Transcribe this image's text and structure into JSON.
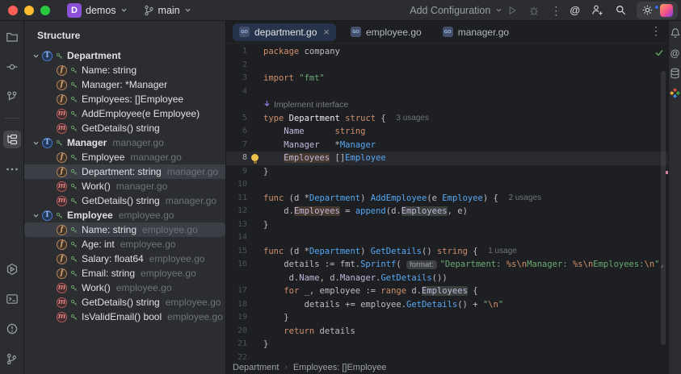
{
  "colors": {
    "accent": "#3574F0",
    "editor_bg": "#1E1F22",
    "panel_bg": "#2B2D30",
    "keyword": "#CF8E6D",
    "string": "#6AAB73",
    "function": "#56A8F5",
    "selection_row": "#3B3E44"
  },
  "window": {
    "project_badge": "D",
    "project": "demos",
    "branch": "main",
    "run_config": "Add Configuration",
    "window_controls": [
      "close",
      "minimize",
      "zoom"
    ],
    "topbar_icons": [
      "chevron-down",
      "git-branch",
      "run",
      "debug",
      "kebab-menu",
      "ai-assistant",
      "add-user",
      "search",
      "settings",
      "avatar"
    ]
  },
  "left_toolbar": {
    "top": [
      "folder",
      "commit",
      "vcs-graph",
      "structure",
      "more"
    ],
    "active": "structure",
    "bottom": [
      "run",
      "terminal",
      "problems",
      "git-branch"
    ]
  },
  "right_toolbar": [
    "notifications",
    "ai-assistant",
    "database",
    "plugins"
  ],
  "icons": {
    "kebab": "⋮",
    "close": "×",
    "more_dots": "···",
    "at": "@"
  },
  "structure_panel": {
    "title": "Structure",
    "items": [
      {
        "kind": "T",
        "label": "Department",
        "indent": 0,
        "chevron": true
      },
      {
        "kind": "f",
        "label": "Name: string",
        "indent": 1
      },
      {
        "kind": "f",
        "label": "Manager: *Manager",
        "indent": 1
      },
      {
        "kind": "f",
        "label": "Employees: []Employee",
        "indent": 1
      },
      {
        "kind": "m",
        "label": "AddEmployee(e Employee)",
        "indent": 1
      },
      {
        "kind": "m",
        "label": "GetDetails() string",
        "indent": 1
      },
      {
        "kind": "T",
        "label": "Manager",
        "suffix": "manager.go",
        "indent": 0,
        "chevron": true
      },
      {
        "kind": "f",
        "label": "Employee",
        "suffix": "manager.go",
        "indent": 1
      },
      {
        "kind": "f",
        "label": "Department: string",
        "suffix": "manager.go",
        "indent": 1,
        "selected": true
      },
      {
        "kind": "m",
        "label": "Work()",
        "suffix": "manager.go",
        "indent": 1
      },
      {
        "kind": "m",
        "label": "GetDetails() string",
        "suffix": "manager.go",
        "indent": 1
      },
      {
        "kind": "T",
        "label": "Employee",
        "suffix": "employee.go",
        "indent": 0,
        "chevron": true
      },
      {
        "kind": "f",
        "label": "Name: string",
        "suffix": "employee.go",
        "indent": 1,
        "selected": true,
        "rounded": true
      },
      {
        "kind": "f",
        "label": "Age: int",
        "suffix": "employee.go",
        "indent": 1
      },
      {
        "kind": "f",
        "label": "Salary: float64",
        "suffix": "employee.go",
        "indent": 1
      },
      {
        "kind": "f",
        "label": "Email: string",
        "suffix": "employee.go",
        "indent": 1
      },
      {
        "kind": "m",
        "label": "Work()",
        "suffix": "employee.go",
        "indent": 1
      },
      {
        "kind": "m",
        "label": "GetDetails() string",
        "suffix": "employee.go",
        "indent": 1
      },
      {
        "kind": "m",
        "label": "IsValidEmail() bool",
        "suffix": "employee.go",
        "indent": 1
      }
    ]
  },
  "editor": {
    "tabs": [
      {
        "label": "department.go",
        "active": true,
        "close_icon": true
      },
      {
        "label": "employee.go"
      },
      {
        "label": "manager.go"
      }
    ],
    "tab_kebab": "⋮",
    "breadcrumbs": [
      "Department",
      "Employees: []Employee"
    ],
    "lines": [
      {
        "n": "1",
        "seg": [
          [
            "kw",
            "package"
          ],
          [
            "df",
            " company"
          ]
        ]
      },
      {
        "n": "2",
        "seg": []
      },
      {
        "n": "3",
        "seg": [
          [
            "kw",
            "import"
          ],
          [
            "df",
            " "
          ],
          [
            "str",
            "\"fmt\""
          ]
        ]
      },
      {
        "n": "4",
        "seg": []
      },
      {
        "n": "",
        "hint": "Implement interface"
      },
      {
        "n": "5",
        "seg": [
          [
            "kw",
            "type"
          ],
          [
            "df",
            " "
          ],
          [
            "decl",
            "Department"
          ],
          [
            "df",
            " "
          ],
          [
            "kw",
            "struct"
          ],
          [
            "df",
            " {  "
          ]
        ],
        "usage": "3 usages"
      },
      {
        "n": "6",
        "seg": [
          [
            "df",
            "    "
          ],
          [
            "fld",
            "Name"
          ],
          [
            "df",
            "      "
          ],
          [
            "kw",
            "string"
          ]
        ]
      },
      {
        "n": "7",
        "seg": [
          [
            "df",
            "    "
          ],
          [
            "fld",
            "Manager"
          ],
          [
            "df",
            "   *"
          ],
          [
            "typ",
            "Manager"
          ]
        ]
      },
      {
        "n": "8",
        "cur": true,
        "bulb": true,
        "seg": [
          [
            "df",
            "    "
          ],
          [
            "fld bw",
            "Employees"
          ],
          [
            "df",
            " []"
          ],
          [
            "typ",
            "Employee"
          ]
        ]
      },
      {
        "n": "9",
        "seg": [
          [
            "df",
            "}"
          ]
        ]
      },
      {
        "n": "10",
        "seg": []
      },
      {
        "n": "11",
        "seg": [
          [
            "kw",
            "func"
          ],
          [
            "df",
            " (d *"
          ],
          [
            "typ",
            "Department"
          ],
          [
            "df",
            ") "
          ],
          [
            "fn",
            "AddEmployee"
          ],
          [
            "df",
            "(e "
          ],
          [
            "typ",
            "Employee"
          ],
          [
            "df",
            ") {  "
          ]
        ],
        "usage": "2 usages"
      },
      {
        "n": "12",
        "seg": [
          [
            "df",
            "    d."
          ],
          [
            "fld bw",
            "Employees"
          ],
          [
            "df",
            " = "
          ],
          [
            "fn",
            "append"
          ],
          [
            "df",
            "(d."
          ],
          [
            "fld br",
            "Employees"
          ],
          [
            "df",
            ", e)"
          ]
        ]
      },
      {
        "n": "13",
        "seg": [
          [
            "df",
            "}"
          ]
        ]
      },
      {
        "n": "14",
        "seg": []
      },
      {
        "n": "15",
        "seg": [
          [
            "kw",
            "func"
          ],
          [
            "df",
            " (d *"
          ],
          [
            "typ",
            "Department"
          ],
          [
            "df",
            ") "
          ],
          [
            "fn",
            "GetDetails"
          ],
          [
            "df",
            "() "
          ],
          [
            "kw",
            "string"
          ],
          [
            "df",
            " {  "
          ]
        ],
        "usage": "1 usage"
      },
      {
        "n": "16",
        "chip": "format:",
        "seg": [
          [
            "df",
            "    details := fmt."
          ],
          [
            "fn",
            "Sprintf"
          ],
          [
            "df",
            "( "
          ],
          [
            "CHIP",
            ""
          ],
          [
            "str",
            "\"Department: "
          ],
          [
            "esc",
            "%s\\n"
          ],
          [
            "str",
            "Manager: "
          ],
          [
            "esc",
            "%s\\n"
          ],
          [
            "str",
            "Employees:"
          ],
          [
            "esc",
            "\\n"
          ],
          [
            "str",
            "\""
          ],
          [
            "df",
            ","
          ]
        ]
      },
      {
        "n": "",
        "seg": [
          [
            "df",
            "     d."
          ],
          [
            "fld",
            "Name"
          ],
          [
            "df",
            ", d."
          ],
          [
            "fld",
            "Manager"
          ],
          [
            "df",
            "."
          ],
          [
            "fn",
            "GetDetails"
          ],
          [
            "df",
            "())"
          ]
        ]
      },
      {
        "n": "17",
        "seg": [
          [
            "df",
            "    "
          ],
          [
            "kw",
            "for"
          ],
          [
            "df",
            " _, employee := "
          ],
          [
            "kw",
            "range"
          ],
          [
            "df",
            " d."
          ],
          [
            "fld br",
            "Employees"
          ],
          [
            "df",
            " {"
          ]
        ]
      },
      {
        "n": "18",
        "seg": [
          [
            "df",
            "        details += employee."
          ],
          [
            "fn",
            "GetDetails"
          ],
          [
            "df",
            "() + "
          ],
          [
            "str",
            "\""
          ],
          [
            "esc",
            "\\n"
          ],
          [
            "str",
            "\""
          ]
        ]
      },
      {
        "n": "19",
        "seg": [
          [
            "df",
            "    }"
          ]
        ]
      },
      {
        "n": "20",
        "seg": [
          [
            "df",
            "    "
          ],
          [
            "kw",
            "return"
          ],
          [
            "df",
            " details"
          ]
        ]
      },
      {
        "n": "21",
        "seg": [
          [
            "df",
            "}"
          ]
        ]
      },
      {
        "n": "22",
        "seg": []
      }
    ]
  }
}
